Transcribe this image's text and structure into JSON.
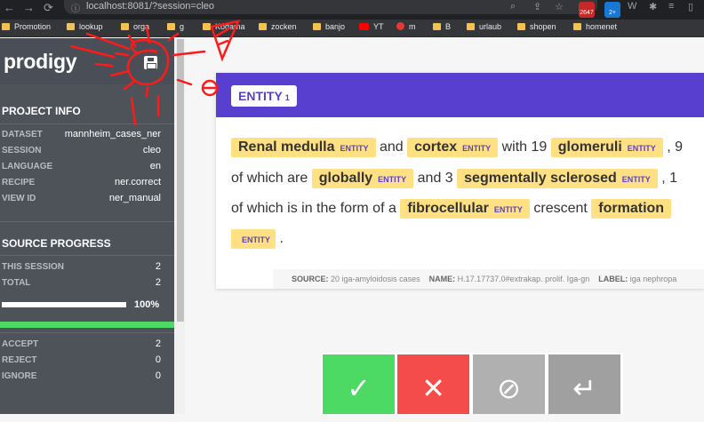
{
  "browser": {
    "url": "localhost:8081/?session=cleo",
    "ext_badge_count": "2647",
    "ext_badge2": "2+",
    "bookmarks": [
      "Promotion",
      "lookup",
      "orga",
      "g",
      "Kodama",
      "zocken",
      "banjo",
      "YT",
      "m",
      "B",
      "urlaub",
      "shopen",
      "homenet"
    ]
  },
  "sidebar": {
    "logo": "prodigy",
    "project_info": {
      "title": "PROJECT INFO",
      "rows": [
        {
          "label": "DATASET",
          "value": "mannheim_cases_ner"
        },
        {
          "label": "SESSION",
          "value": "cleo"
        },
        {
          "label": "LANGUAGE",
          "value": "en"
        },
        {
          "label": "RECIPE",
          "value": "ner.correct"
        },
        {
          "label": "VIEW ID",
          "value": "ner_manual"
        }
      ]
    },
    "source_progress": {
      "title": "SOURCE PROGRESS",
      "this_session_label": "THIS SESSION",
      "this_session": "2",
      "total_label": "TOTAL",
      "total": "2",
      "percent": "100%",
      "progress_fraction": 1.0
    },
    "counts": [
      {
        "label": "ACCEPT",
        "value": "2"
      },
      {
        "label": "REJECT",
        "value": "0"
      },
      {
        "label": "IGNORE",
        "value": "0"
      }
    ]
  },
  "card": {
    "label": "ENTITY",
    "label_key": "1",
    "entity_tag": "ENTITY",
    "text": {
      "e1": "Renal medulla",
      "t1": "and",
      "e2": "cortex",
      "t2": "with 19",
      "e3": "glomeruli",
      "t3": ", 9",
      "t4": "of which are",
      "e4": "globally",
      "t5": "and 3",
      "e5": "segmentally sclerosed",
      "t6": ", 1",
      "t7": "of which is in the form of a",
      "e6": "fibrocellular",
      "t8": "crescent",
      "e7": "formation",
      "t9": "."
    },
    "meta": {
      "source_label": "SOURCE:",
      "source": "20 iga-amyloidosis cases",
      "name_label": "NAME:",
      "name": "H.17.17737.0#extrakap. prolif. Iga-gn",
      "label_label": "LABEL:",
      "label": "iga nephropa"
    }
  },
  "actions": {
    "accept_icon": "check-icon",
    "reject_icon": "x-icon",
    "ignore_icon": "ban-icon",
    "undo_icon": "undo-icon",
    "colors": {
      "accept": "#4cd964",
      "reject": "#f44b4b",
      "ignore": "#b0b0b0",
      "undo": "#a0a0a0"
    }
  },
  "theme": {
    "primary": "#583fcf",
    "entity_bg": "#ffe184",
    "sidebar": "#4e535a",
    "annotation": "#ff1a1a"
  }
}
